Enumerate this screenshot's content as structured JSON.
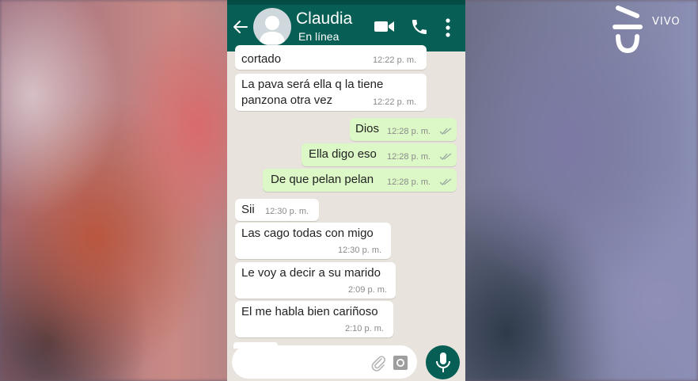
{
  "overlay": {
    "channel_label": "VIVO"
  },
  "header": {
    "contact_name": "Claudia",
    "status": "En línea",
    "icons": [
      "back-arrow-icon",
      "avatar-placeholder",
      "video-call-icon",
      "phone-call-icon",
      "more-vert-icon"
    ]
  },
  "messages": [
    {
      "dir": "in",
      "text": "cortado",
      "time": "12:22 p. m."
    },
    {
      "dir": "in",
      "text_line1": "La pava será ella q la tiene",
      "text_line2": "panzona otra vez",
      "time": "12:22 p. m."
    },
    {
      "dir": "out",
      "text": "Dios",
      "time": "12:28 p. m."
    },
    {
      "dir": "out",
      "text": "Ella digo eso",
      "time": "12:28 p. m."
    },
    {
      "dir": "out",
      "text": "De que pelan pelan",
      "time": "12:28 p. m."
    },
    {
      "dir": "in",
      "text": "Sii",
      "time": "12:30 p. m."
    },
    {
      "dir": "in",
      "text": "Las cago todas con migo",
      "time": "12:30 p. m."
    },
    {
      "dir": "in",
      "text": "Le voy a decir a su marido",
      "time": "2:09 p. m."
    },
    {
      "dir": "in",
      "text": "El me habla bien cariñoso",
      "time": "2:10 p. m."
    }
  ],
  "composer": {
    "icons": [
      "attach-icon",
      "camera-icon",
      "mic-icon"
    ]
  },
  "colors": {
    "header": "#075e54",
    "chat_bg": "#e8e3dc",
    "incoming": "#ffffff",
    "outgoing": "#dcf8c6",
    "ticks": "#9aa7a0"
  }
}
